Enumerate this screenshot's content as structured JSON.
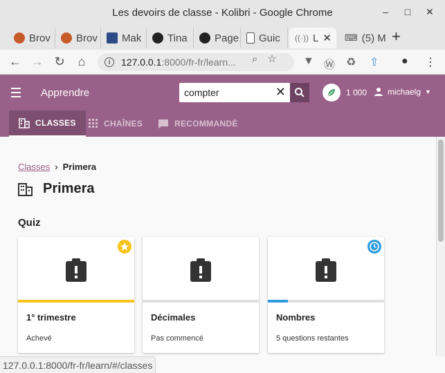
{
  "window": {
    "title": "Les devoirs de classe - Kolibri - Google Chrome"
  },
  "tabs": [
    {
      "label": "Brov",
      "icon": "chrome-icon"
    },
    {
      "label": "Brov",
      "icon": "chrome-icon"
    },
    {
      "label": "Mak",
      "icon": "make-icon"
    },
    {
      "label": "Tina",
      "icon": "github-icon"
    },
    {
      "label": "Page",
      "icon": "github-icon"
    },
    {
      "label": "Guic",
      "icon": "page-icon"
    },
    {
      "label": "L",
      "icon": "kolibri-icon"
    },
    {
      "label": "(5) M",
      "icon": "keyboard-icon"
    }
  ],
  "address": {
    "host": "127.0.0.1",
    "path": ":8000/fr-fr/learn..."
  },
  "app": {
    "title": "Apprendre",
    "search_value": "compter",
    "points": "1 000",
    "username": "michaelg"
  },
  "nav": {
    "classes": "CLASSES",
    "channels": "CHAÎNES",
    "recommended": "RECOMMANDÉ"
  },
  "breadcrumb": {
    "parent": "Classes",
    "separator": "›",
    "current": "Primera"
  },
  "page": {
    "title": "Primera",
    "section": "Quiz"
  },
  "quizzes": [
    {
      "name": "1° trimestre",
      "status": "Achevé",
      "progress": 1.0,
      "color": "#f8c41c",
      "badge": "star-icon"
    },
    {
      "name": "Décimales",
      "status": "Pas commencé",
      "progress": 0.0,
      "color": "#e0e0e0",
      "badge": ""
    },
    {
      "name": "Nombres",
      "status": "5 questions restantes",
      "progress": 0.17,
      "color": "#2d9be2",
      "badge": "clock-icon"
    }
  ],
  "statusbar": {
    "url": "127.0.0.1:8000/fr-fr/learn/#/classes"
  },
  "colors": {
    "brand": "#996189",
    "brand_dark": "#6e4263",
    "star": "#f8c41c",
    "progress": "#2d9be2"
  }
}
